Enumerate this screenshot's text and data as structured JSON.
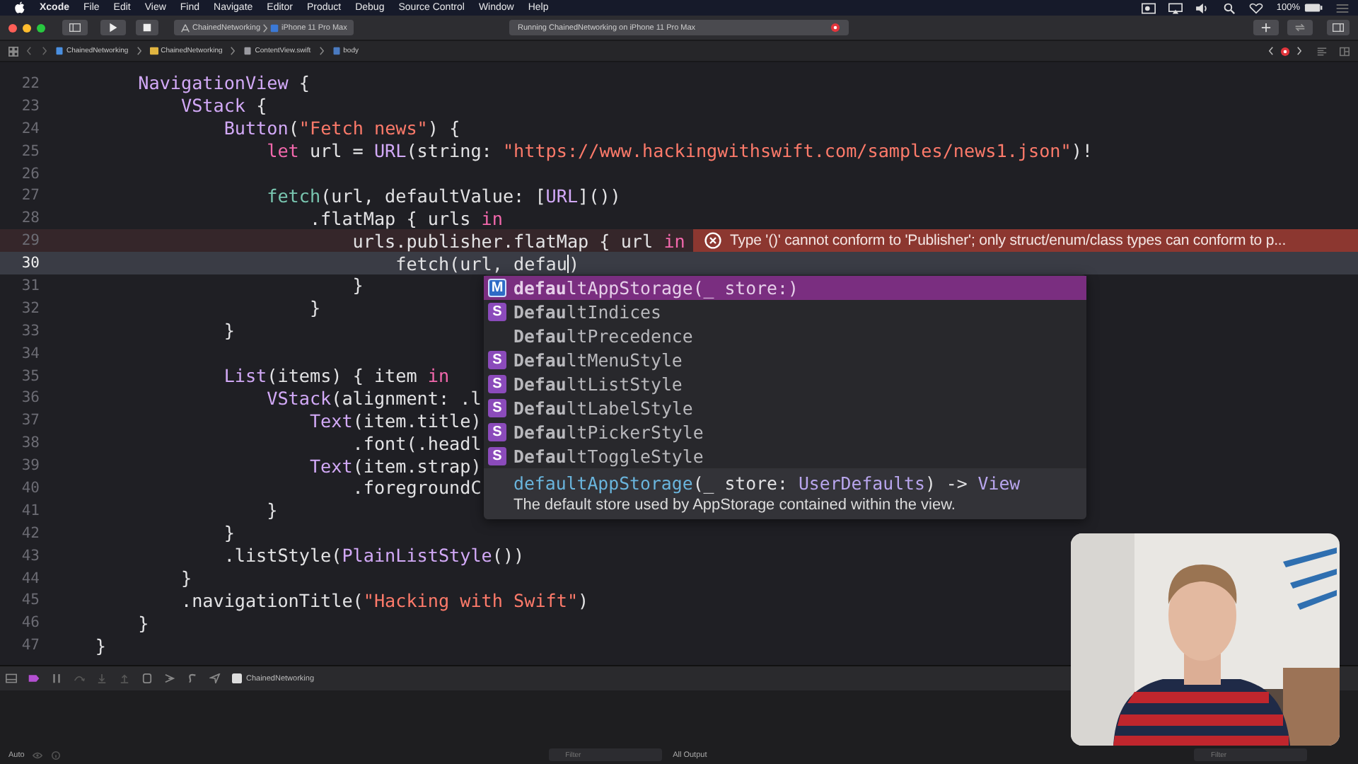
{
  "menu_bar": {
    "app": "Xcode",
    "menus": [
      "File",
      "Edit",
      "View",
      "Find",
      "Navigate",
      "Editor",
      "Product",
      "Debug",
      "Source Control",
      "Window",
      "Help"
    ],
    "battery": "100%"
  },
  "toolbar": {
    "scheme": "ChainedNetworking",
    "device": "iPhone 11 Pro Max",
    "activity": "Running ChainedNetworking on iPhone 11 Pro Max"
  },
  "breadcrumbs": [
    {
      "label": "ChainedNetworking",
      "kind": "project"
    },
    {
      "label": "ChainedNetworking",
      "kind": "folder"
    },
    {
      "label": "ContentView.swift",
      "kind": "file"
    },
    {
      "label": "body",
      "kind": "property"
    }
  ],
  "editor": {
    "lines": [
      {
        "number": "22",
        "current": false,
        "error": false,
        "tokens": [
          {
            "t": "        NavigationView",
            "color": "#d2a9f7"
          },
          {
            "t": " {",
            "color": "#e2e2e4"
          }
        ]
      },
      {
        "number": "23",
        "current": false,
        "error": false,
        "tokens": [
          {
            "t": "            VStack",
            "color": "#d2a9f7"
          },
          {
            "t": " {",
            "color": "#e2e2e4"
          }
        ]
      },
      {
        "number": "24",
        "current": false,
        "error": false,
        "tokens": [
          {
            "t": "                Button",
            "color": "#d2a9f7"
          },
          {
            "t": "(",
            "color": "#e2e2e4"
          },
          {
            "t": "\"Fetch news\"",
            "color": "#fd7a6a"
          },
          {
            "t": ") {",
            "color": "#e2e2e4"
          }
        ]
      },
      {
        "number": "25",
        "current": false,
        "error": false,
        "tokens": [
          {
            "t": "                    let",
            "color": "#f268ac"
          },
          {
            "t": " url = ",
            "color": "#e2e2e4"
          },
          {
            "t": "URL",
            "color": "#d2a9f7"
          },
          {
            "t": "(string: ",
            "color": "#e2e2e4"
          },
          {
            "t": "\"https://www.hackingwithswift.com/samples/news1.json\"",
            "color": "#fd7a6a"
          },
          {
            "t": ")!",
            "color": "#e2e2e4"
          }
        ]
      },
      {
        "number": "26",
        "current": false,
        "error": false
      },
      {
        "number": "27",
        "current": false,
        "error": false,
        "tokens": [
          {
            "t": "                    fetch",
            "color": "#79c6b0"
          },
          {
            "t": "(url, defaultValue: [",
            "color": "#e2e2e4"
          },
          {
            "t": "URL",
            "color": "#d2a9f7"
          },
          {
            "t": "]())",
            "color": "#e2e2e4"
          }
        ]
      },
      {
        "number": "28",
        "current": false,
        "error": false,
        "tokens": [
          {
            "t": "                        .flatMap { urls ",
            "color": "#e2e2e4"
          },
          {
            "t": "in",
            "color": "#f268ac"
          }
        ]
      },
      {
        "number": "29",
        "current": false,
        "error": true,
        "error_message": "Type '()' cannot conform to 'Publisher'; only struct/enum/class types can conform to p...",
        "tokens": [
          {
            "t": "                            urls.publisher.flatMap { url ",
            "color": "#e2e2e4"
          },
          {
            "t": "in",
            "color": "#f268ac"
          }
        ]
      },
      {
        "number": "30",
        "current": true,
        "error": false,
        "tokens": [
          {
            "t": "                                fetch(url, defau",
            "color": "#e2e2e4",
            "cursor": true
          },
          {
            "t": ")",
            "color": "#e2e2e4"
          }
        ]
      },
      {
        "number": "31",
        "current": false,
        "error": false,
        "tokens": [
          {
            "t": "                            }",
            "color": "#e2e2e4"
          }
        ]
      },
      {
        "number": "32",
        "current": false,
        "error": false,
        "tokens": [
          {
            "t": "                        }",
            "color": "#e2e2e4"
          }
        ]
      },
      {
        "number": "33",
        "current": false,
        "error": false,
        "tokens": [
          {
            "t": "                }",
            "color": "#e2e2e4"
          }
        ]
      },
      {
        "number": "34",
        "current": false,
        "error": false
      },
      {
        "number": "35",
        "current": false,
        "error": false,
        "tokens": [
          {
            "t": "                List",
            "color": "#d2a9f7"
          },
          {
            "t": "(items) { item ",
            "color": "#e2e2e4"
          },
          {
            "t": "in",
            "color": "#f268ac"
          }
        ]
      },
      {
        "number": "36",
        "current": false,
        "error": false,
        "tokens": [
          {
            "t": "                    VStack",
            "color": "#d2a9f7"
          },
          {
            "t": "(alignment: .l",
            "color": "#e2e2e4"
          }
        ]
      },
      {
        "number": "37",
        "current": false,
        "error": false,
        "tokens": [
          {
            "t": "                        Text",
            "color": "#d2a9f7"
          },
          {
            "t": "(item.title)",
            "color": "#e2e2e4"
          }
        ]
      },
      {
        "number": "38",
        "current": false,
        "error": false,
        "tokens": [
          {
            "t": "                            .font(.headl",
            "color": "#e2e2e4"
          }
        ]
      },
      {
        "number": "39",
        "current": false,
        "error": false,
        "tokens": [
          {
            "t": "                        Text",
            "color": "#d2a9f7"
          },
          {
            "t": "(item.strap)",
            "color": "#e2e2e4"
          }
        ]
      },
      {
        "number": "40",
        "current": false,
        "error": false,
        "tokens": [
          {
            "t": "                            .foregroundC",
            "color": "#e2e2e4"
          }
        ]
      },
      {
        "number": "41",
        "current": false,
        "error": false,
        "tokens": [
          {
            "t": "                    }",
            "color": "#e2e2e4"
          }
        ]
      },
      {
        "number": "42",
        "current": false,
        "error": false,
        "tokens": [
          {
            "t": "                }",
            "color": "#e2e2e4"
          }
        ]
      },
      {
        "number": "43",
        "current": false,
        "error": false,
        "tokens": [
          {
            "t": "                .listStyle(",
            "color": "#e2e2e4"
          },
          {
            "t": "PlainListStyle",
            "color": "#d2a9f7"
          },
          {
            "t": "())",
            "color": "#e2e2e4"
          }
        ]
      },
      {
        "number": "44",
        "current": false,
        "error": false,
        "tokens": [
          {
            "t": "            }",
            "color": "#e2e2e4"
          }
        ]
      },
      {
        "number": "45",
        "current": false,
        "error": false,
        "tokens": [
          {
            "t": "            .navigationTitle(",
            "color": "#e2e2e4"
          },
          {
            "t": "\"Hacking with Swift\"",
            "color": "#fd7a6a"
          },
          {
            "t": ")",
            "color": "#e2e2e4"
          }
        ]
      },
      {
        "number": "46",
        "current": false,
        "error": false,
        "tokens": [
          {
            "t": "        }",
            "color": "#e2e2e4"
          }
        ]
      },
      {
        "number": "47",
        "current": false,
        "error": false,
        "tokens": [
          {
            "t": "    }",
            "color": "#e2e2e4"
          }
        ]
      }
    ]
  },
  "completion": {
    "items": [
      {
        "badge": "M",
        "kind": "method",
        "label": "**defau**ltAppStorage(_ store:)",
        "selected": true
      },
      {
        "badge": "S",
        "kind": "struct",
        "label": "**Defau**ltIndices",
        "selected": false
      },
      {
        "label": "**Defau**ltPrecedence",
        "selected": false
      },
      {
        "badge": "S",
        "kind": "struct",
        "label": "**Defau**ltMenuStyle",
        "selected": false
      },
      {
        "badge": "S",
        "kind": "struct",
        "label": "**Defau**ltListStyle",
        "selected": false
      },
      {
        "badge": "S",
        "kind": "struct",
        "label": "**Defau**ltLabelStyle",
        "selected": false
      },
      {
        "badge": "S",
        "kind": "struct",
        "label": "**Defau**ltPickerStyle",
        "selected": false
      },
      {
        "badge": "S",
        "kind": "struct",
        "label": "**Defau**ltToggleStyle",
        "selected": false
      }
    ],
    "signature": [
      {
        "t": "defaultAppStorage",
        "color": "#6ab5dd"
      },
      {
        "t": "(_ store: ",
        "color": "#e2e2e4"
      },
      {
        "t": "UserDefaults",
        "color": "#b9a6ee"
      },
      {
        "t": ") -> ",
        "color": "#e2e2e4"
      },
      {
        "t": "View",
        "color": "#b9a6ee"
      }
    ],
    "description": "The default store used by AppStorage contained within the view."
  },
  "debug_bar": {
    "target": "ChainedNetworking"
  },
  "console": {
    "scope": "Auto",
    "filter_placeholder": "Filter",
    "output": "All Output",
    "output_filter_placeholder": "Filter"
  }
}
